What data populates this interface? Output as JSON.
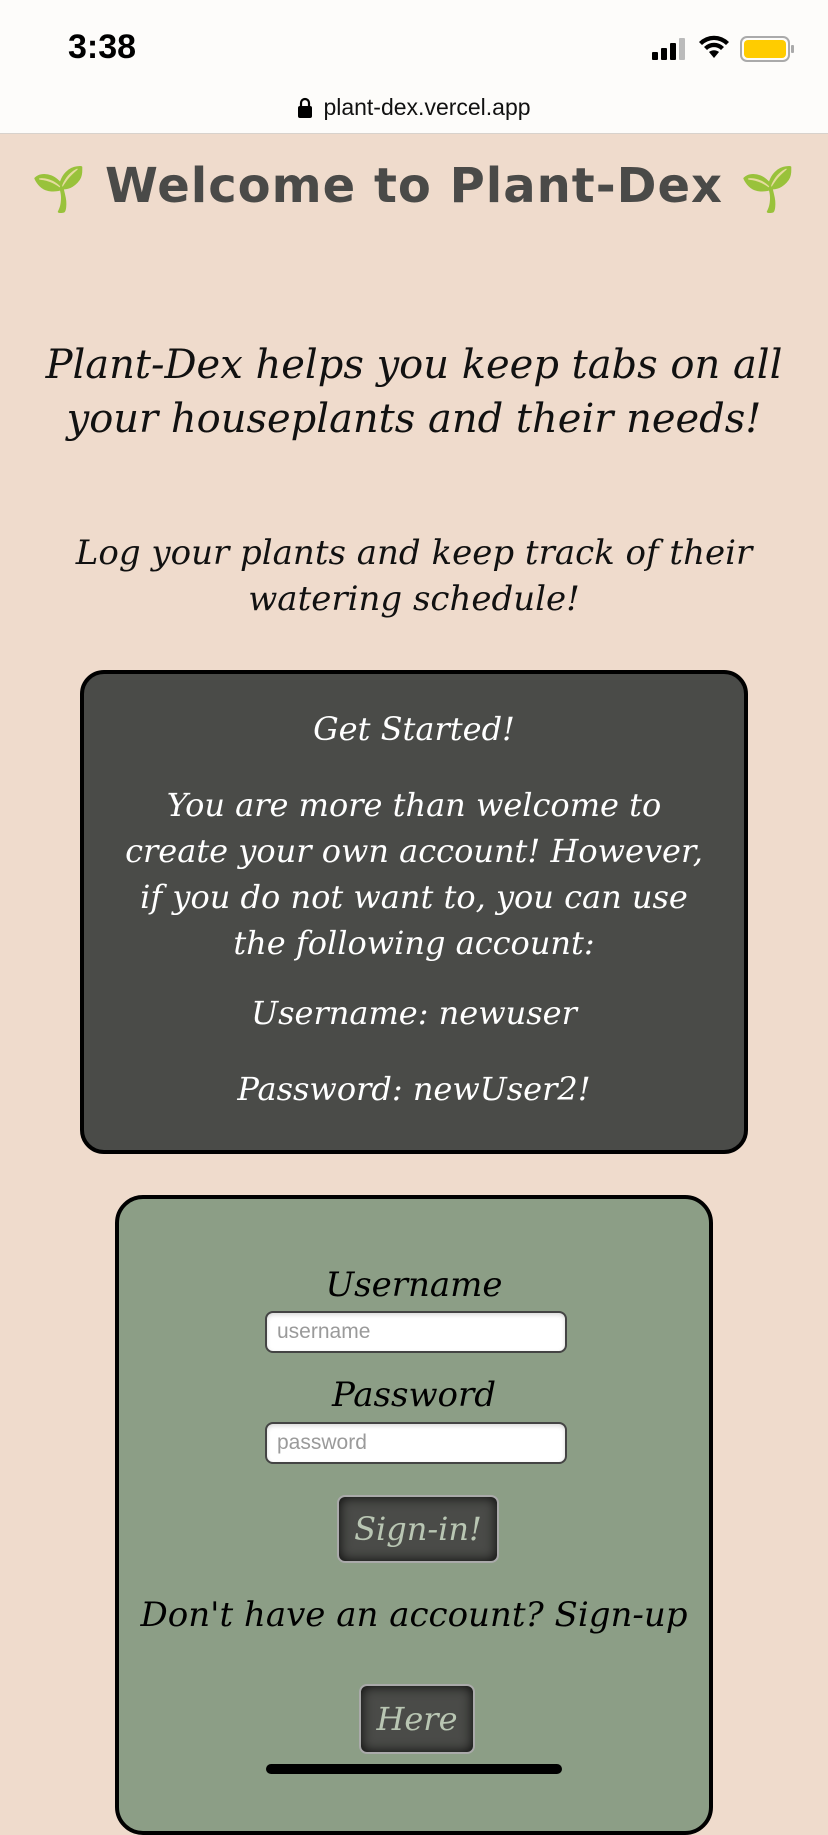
{
  "status_bar": {
    "time": "3:38",
    "icons": [
      "signal-icon",
      "wifi-icon",
      "battery-icon"
    ],
    "battery_color": "#ffcc00"
  },
  "browser": {
    "url": "plant-dex.vercel.app",
    "lock_icon": "lock-icon"
  },
  "header": {
    "sprout_left": "🌱",
    "title": "Welcome to Plant-Dex",
    "sprout_right": "🌱"
  },
  "intro": {
    "line1": "Plant-Dex helps you keep tabs on all your houseplants and their needs!",
    "line2": "Log your plants and keep track of their watering schedule!"
  },
  "info_card": {
    "title": "Get Started!",
    "body": "You are more than welcome to create your own account! However, if you do not want to, you can use the following account:",
    "username_line": "Username: newuser",
    "password_line": "Password: newUser2!"
  },
  "login_form": {
    "username_label": "Username",
    "username_placeholder": "username",
    "password_label": "Password",
    "password_placeholder": "password",
    "signin_button": "Sign-in!",
    "signup_prompt": "Don't have an account? Sign-up",
    "here_button": "Here"
  },
  "colors": {
    "page_bg": "#efdbcc",
    "info_card_bg": "#4a4b48",
    "login_card_bg": "#8c9e86",
    "button_text": "#b9c6b3"
  }
}
